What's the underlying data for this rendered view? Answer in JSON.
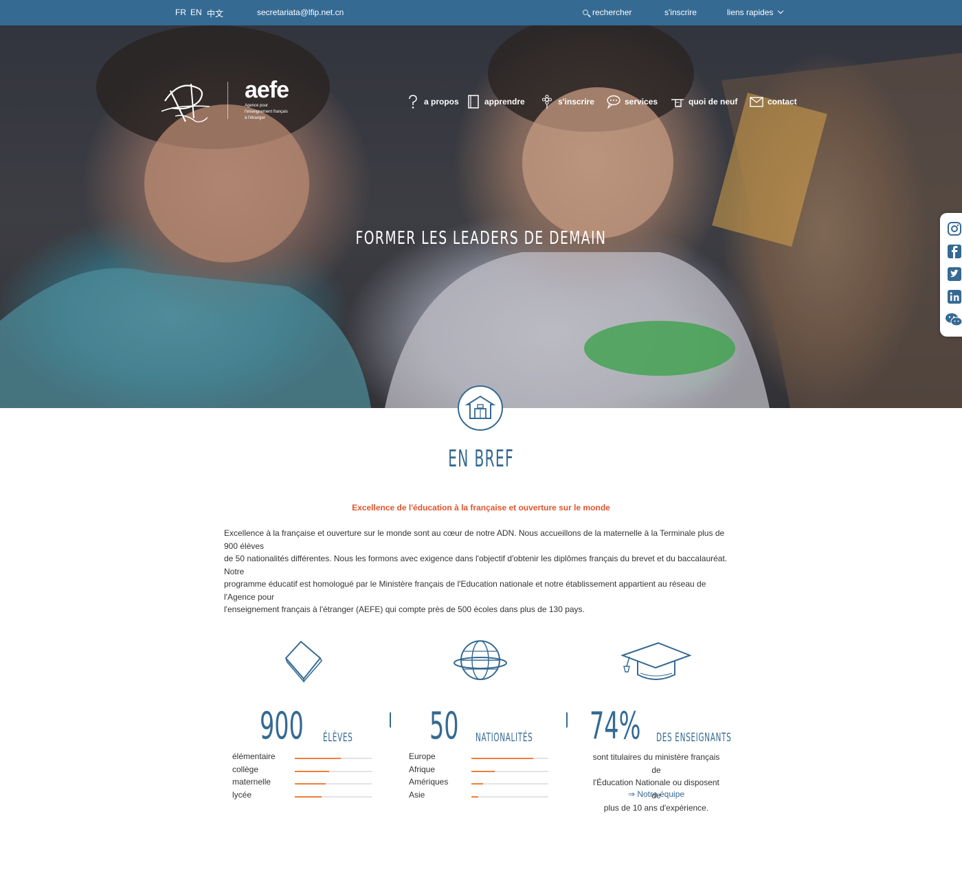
{
  "topbar": {
    "lang_fr": "FR",
    "lang_en": "EN",
    "lang_zh": "中文",
    "email": "secretariata@lfip.net.cn",
    "search": "rechercher",
    "register": "s'inscrire",
    "quick_links": "liens rapides"
  },
  "logo": {
    "aefe": "aefe",
    "aefe_line1": "Agence pour",
    "aefe_line2": "l'enseignement français",
    "aefe_line3": "à l'étranger"
  },
  "nav": {
    "items": [
      {
        "label": "a propos",
        "icon": "question-icon"
      },
      {
        "label": "apprendre",
        "icon": "book-icon"
      },
      {
        "label": "s'inscrire",
        "icon": "flower-icon"
      },
      {
        "label": "services",
        "icon": "chat-bubble-icon"
      },
      {
        "label": "quoi de neuf",
        "icon": "pointing-hand-icon"
      },
      {
        "label": "contact",
        "icon": "envelope-icon"
      }
    ]
  },
  "hero": {
    "title": "FORMER LES LEADERS DE DEMAIN"
  },
  "social": [
    "instagram-icon",
    "facebook-icon",
    "twitter-icon",
    "linkedin-icon",
    "wechat-icon"
  ],
  "section": {
    "title": "EN BREF",
    "subtitle": "Excellence de l'éducation à la française et ouverture sur le monde",
    "intro_lines": [
      "Excellence à la française et ouverture sur le monde sont au cœur de notre ADN. Nous accueillons de la maternelle à la Terminale plus de 900 élèves",
      "de 50 nationalités différentes. Nous les formons avec exigence dans l'objectif d'obtenir les diplômes français du brevet et du baccalauréat. Notre",
      "programme éducatif est homologué par le Ministère français de l'Education nationale et notre établissement appartient au réseau de l'Agence pour",
      "l'enseignement français à l'étranger (AEFE) qui compte près de 500 écoles dans plus de 130 pays."
    ]
  },
  "stats": {
    "students": {
      "number": "900",
      "label": "ÉLÈVES",
      "rows": [
        {
          "label": "élémentaire",
          "value": 0.6
        },
        {
          "label": "collège",
          "value": 0.45
        },
        {
          "label": "maternelle",
          "value": 0.4
        },
        {
          "label": "lycée",
          "value": 0.35
        }
      ]
    },
    "nationalities": {
      "number": "50",
      "label": "NATIONALITÉS",
      "rows": [
        {
          "label": "Europe",
          "value": 0.8
        },
        {
          "label": "Afrique",
          "value": 0.3
        },
        {
          "label": "Amériques",
          "value": 0.15
        },
        {
          "label": "Asie",
          "value": 0.09
        }
      ]
    },
    "teachers": {
      "number": "74%",
      "label": "DES ENSEIGNANTS",
      "text_lines": [
        "sont titulaires du ministère français de",
        "l'Éducation Nationale ou disposent de",
        "plus de 10 ans d'expérience."
      ],
      "link": "⇒ Notre équipe"
    }
  },
  "colors": {
    "primary": "#356a93",
    "accent": "#e0542d",
    "bar": "#ee7d3b"
  }
}
